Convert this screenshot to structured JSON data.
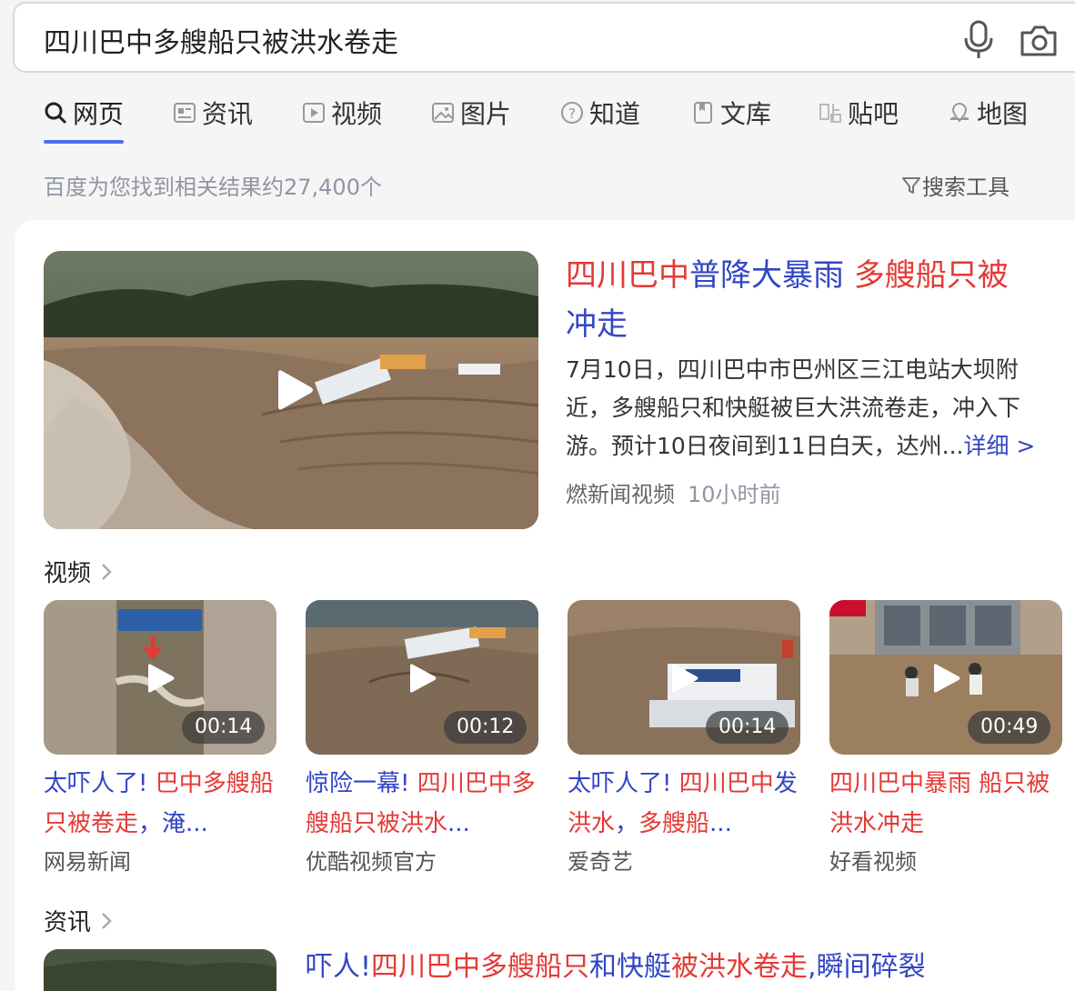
{
  "search": {
    "query": "四川巴中多艘船只被洪水卷走"
  },
  "tabs": [
    {
      "label": "网页",
      "icon": "search-icon"
    },
    {
      "label": "资讯",
      "icon": "news-icon"
    },
    {
      "label": "视频",
      "icon": "video-icon"
    },
    {
      "label": "图片",
      "icon": "image-icon"
    },
    {
      "label": "知道",
      "icon": "question-icon"
    },
    {
      "label": "文库",
      "icon": "doc-icon"
    },
    {
      "label": "贴吧",
      "icon": "tieba-icon"
    },
    {
      "label": "地图",
      "icon": "map-pin-icon"
    }
  ],
  "result_count": "百度为您找到相关结果约27,400个",
  "search_tools": "搜索工具",
  "main_result": {
    "title_parts": [
      "四川巴中",
      "普降大暴雨",
      " 多艘船只被",
      "冲走"
    ],
    "description": "7月10日，四川巴中市巴州区三江电站大坝附近，多艘船只和快艇被巨大洪流卷走，冲入下游。预计10日夜间到11日白天，达州...",
    "more_link": "详细 >",
    "source": "燃新闻视频",
    "time": "10小时前"
  },
  "video_section": {
    "title": "视频",
    "items": [
      {
        "duration": "00:14",
        "title_parts": [
          "太吓人了! ",
          "巴中多艘船只被卷走",
          "，淹..."
        ],
        "source": "网易新闻"
      },
      {
        "duration": "00:12",
        "title_parts": [
          "惊险一幕! ",
          "四川巴中多艘船只被洪水",
          "..."
        ],
        "source": "优酷视频官方"
      },
      {
        "duration": "00:14",
        "title_parts": [
          "太吓人了! ",
          "四川巴中",
          "发",
          "洪水",
          "，",
          "多艘船",
          "..."
        ],
        "source": "爱奇艺"
      },
      {
        "duration": "00:49",
        "title_parts": [
          "四川巴中暴雨",
          " ",
          "船只被洪水冲走"
        ],
        "source": "好看视频"
      }
    ]
  },
  "news_section": {
    "title": "资讯",
    "first_title_parts": [
      "吓人!",
      "四川巴中多艘船只",
      "和快艇",
      "被洪水卷走",
      ",瞬间碎裂"
    ]
  },
  "colors": {
    "accent": "#4e6ef2",
    "title_blue": "#3246c4",
    "highlight_red": "#e53935"
  }
}
